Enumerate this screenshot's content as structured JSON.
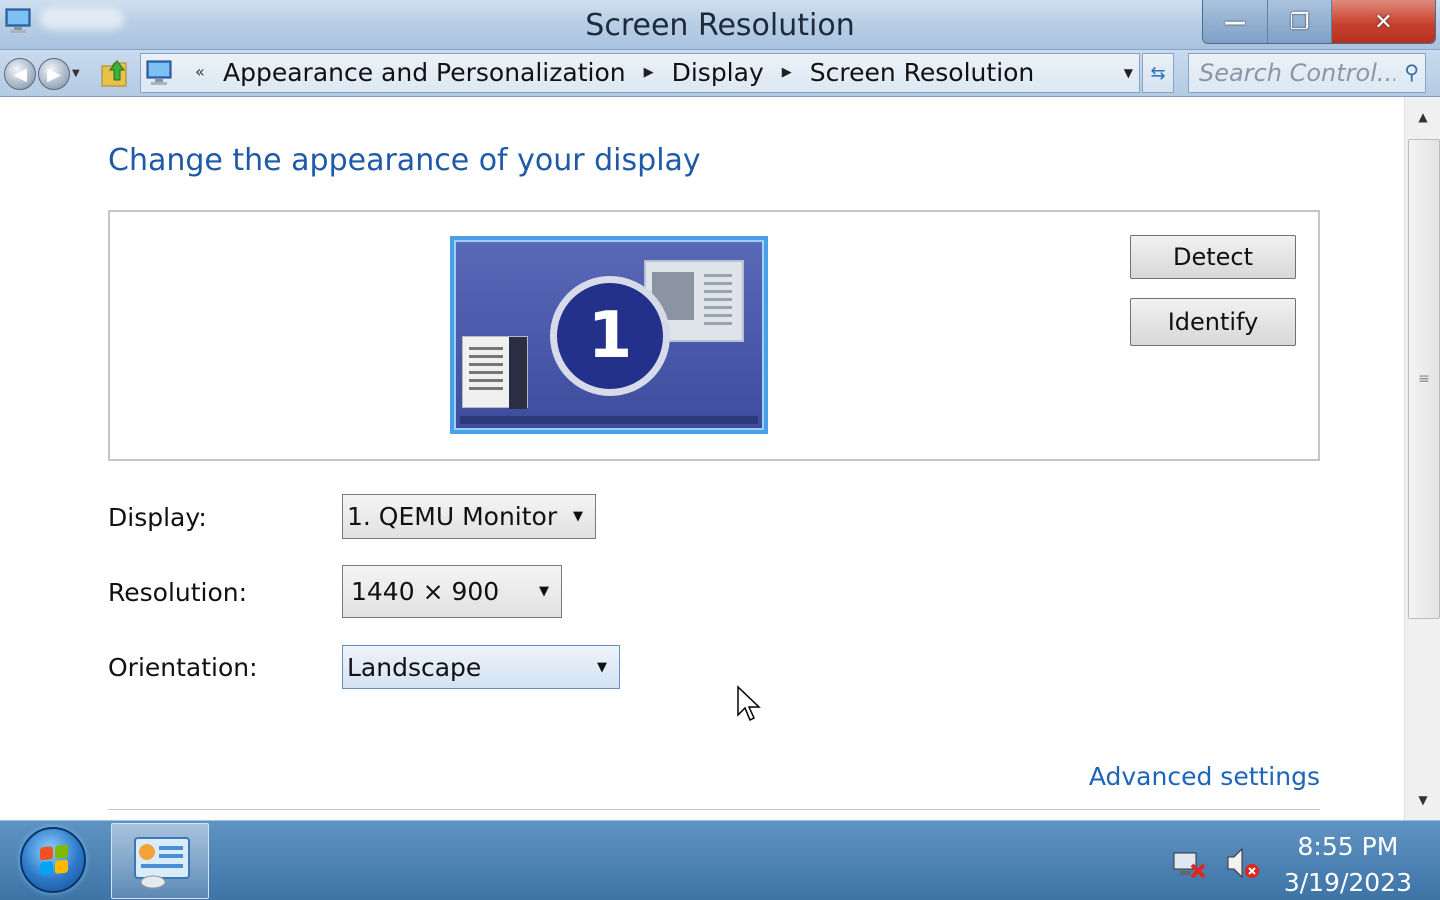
{
  "window": {
    "title": "Screen Resolution",
    "caption_buttons": {
      "minimize": "—",
      "maximize": "❐",
      "close": "✕"
    }
  },
  "address_bar": {
    "overflow_chevron": "«",
    "breadcrumbs": [
      "Appearance and Personalization",
      "Display",
      "Screen Resolution"
    ],
    "search_placeholder": "Search Control..."
  },
  "content": {
    "heading": "Change the appearance of your display",
    "preview": {
      "display_number": "1",
      "detect_label": "Detect",
      "identify_label": "Identify"
    },
    "settings": {
      "display_label": "Display:",
      "display_value": "1. QEMU Monitor",
      "resolution_label": "Resolution:",
      "resolution_value": "1440 × 900",
      "orientation_label": "Orientation:",
      "orientation_value": "Landscape"
    },
    "advanced_link": "Advanced settings"
  },
  "taskbar": {
    "clock_time": "8:55 PM",
    "clock_date": "3/19/2023"
  },
  "colors": {
    "heading_blue": "#1e5aa8",
    "link_blue": "#1e64b8",
    "close_red": "#c7402d",
    "taskbar_blue": "#4a80b3"
  }
}
